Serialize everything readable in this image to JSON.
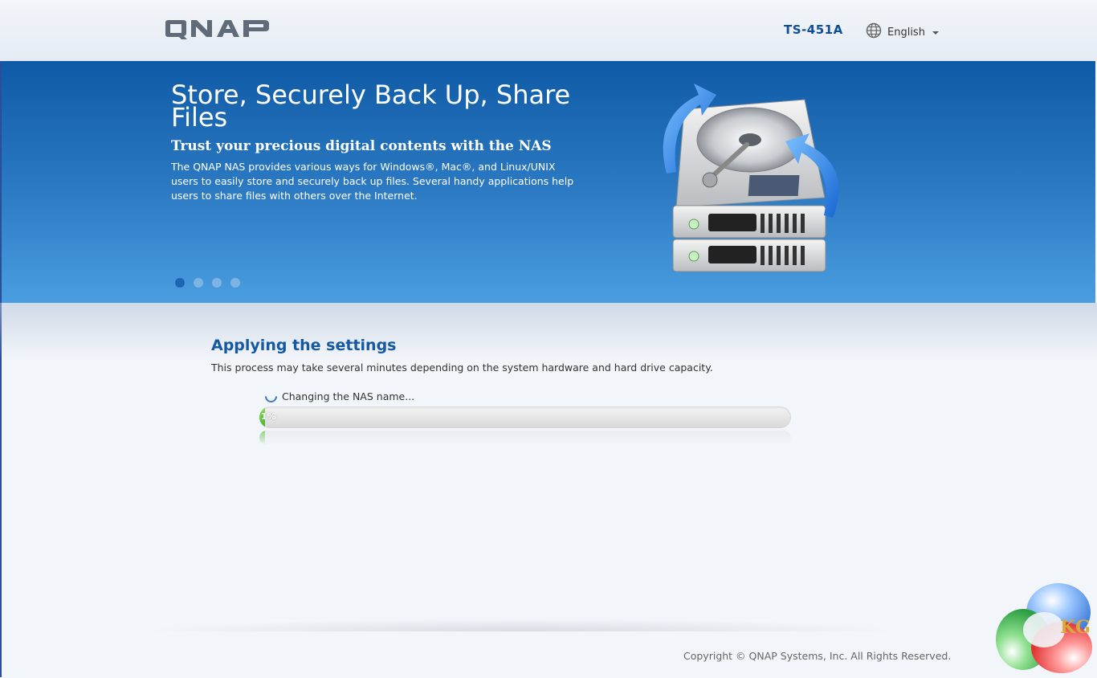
{
  "header": {
    "logo_text": "QNAP",
    "model": "TS-451A",
    "language": "English"
  },
  "banner": {
    "title": "Store, Securely Back Up, Share Files",
    "subtitle": "Trust your precious digital contents with the NAS",
    "description": "The QNAP NAS provides various ways for Windows®, Mac®, and Linux/UNIX users to easily store and securely back up files. Several handy applications help users to share files with others over the Internet.",
    "slides": [
      {
        "active": true
      },
      {
        "active": false
      },
      {
        "active": false
      },
      {
        "active": false
      }
    ]
  },
  "content": {
    "title": "Applying the settings",
    "description": "This process may take several minutes depending on the system hardware and hard drive capacity.",
    "status": "Changing the NAS name...",
    "progress_percent": 1,
    "progress_label": "1%"
  },
  "footer": {
    "copyright": "Copyright © QNAP Systems, Inc. All Rights Reserved."
  },
  "watermark": {
    "text": "KG"
  },
  "colors": {
    "brand_blue": "#1559a3",
    "progress_green": "#4cb32c",
    "banner_blue": "#0f5aa6"
  }
}
